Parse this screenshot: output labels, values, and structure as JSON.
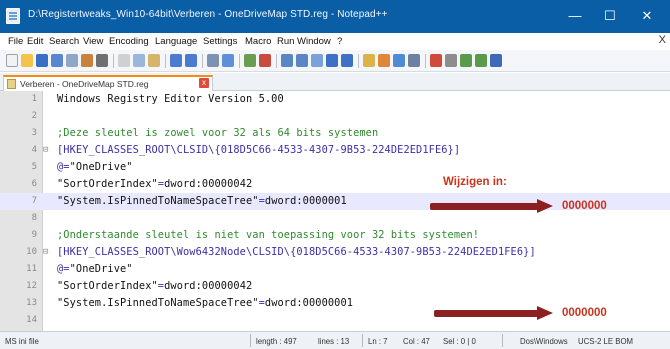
{
  "window": {
    "title": "D:\\Registertweaks_Win10-64bit\\Verberen - OneDriveMap STD.reg - Notepad++",
    "min_glyph": "—",
    "max_glyph": "☐",
    "close_glyph": "✕"
  },
  "menu": {
    "items": [
      "File",
      "Edit",
      "Search",
      "View",
      "Encoding",
      "Language",
      "Settings",
      "Macro",
      "Run",
      "Window",
      "?"
    ],
    "close_glyph": "X"
  },
  "tab": {
    "label": "Verberen - OneDriveMap STD.reg",
    "close_glyph": "x"
  },
  "editor": {
    "current_line_index": 6,
    "lines": [
      {
        "num": "1",
        "fold": "",
        "segments": [
          {
            "t": "Windows Registry Editor Version 5.00",
            "c": "norm"
          }
        ]
      },
      {
        "num": "2",
        "fold": "",
        "segments": []
      },
      {
        "num": "3",
        "fold": "",
        "segments": [
          {
            "t": ";Deze sleutel is zowel voor 32 als 64 bits systemen",
            "c": "comment"
          }
        ]
      },
      {
        "num": "4",
        "fold": "⊟",
        "segments": [
          {
            "t": "[HKEY_CLASSES_ROOT\\CLSID\\{018D5C66-4533-4307-9B53-224DE2ED1FE6}]",
            "c": "key"
          }
        ]
      },
      {
        "num": "5",
        "fold": "",
        "segments": [
          {
            "t": "@=",
            "c": "key"
          },
          {
            "t": "\"OneDrive\"",
            "c": "norm"
          }
        ]
      },
      {
        "num": "6",
        "fold": "",
        "segments": [
          {
            "t": "\"SortOrderIndex\"",
            "c": "norm"
          },
          {
            "t": "=",
            "c": "key"
          },
          {
            "t": "dword:00000042",
            "c": "norm"
          }
        ]
      },
      {
        "num": "7",
        "fold": "",
        "segments": [
          {
            "t": "\"System.IsPinnedToNameSpaceTree\"",
            "c": "norm"
          },
          {
            "t": "=",
            "c": "key"
          },
          {
            "t": "dword:0000001",
            "c": "norm"
          }
        ]
      },
      {
        "num": "8",
        "fold": "",
        "segments": []
      },
      {
        "num": "9",
        "fold": "",
        "segments": [
          {
            "t": ";Onderstaande sleutel is niet van toepassing voor 32 bits systemen!",
            "c": "comment"
          }
        ]
      },
      {
        "num": "10",
        "fold": "⊟",
        "segments": [
          {
            "t": "[HKEY_CLASSES_ROOT\\Wow6432Node\\CLSID\\{018D5C66-4533-4307-9B53-224DE2ED1FE6}]",
            "c": "key"
          }
        ]
      },
      {
        "num": "11",
        "fold": "",
        "segments": [
          {
            "t": "@=",
            "c": "key"
          },
          {
            "t": "\"OneDrive\"",
            "c": "norm"
          }
        ]
      },
      {
        "num": "12",
        "fold": "",
        "segments": [
          {
            "t": "\"SortOrderIndex\"",
            "c": "norm"
          },
          {
            "t": "=",
            "c": "key"
          },
          {
            "t": "dword:00000042",
            "c": "norm"
          }
        ]
      },
      {
        "num": "13",
        "fold": "",
        "segments": [
          {
            "t": "\"System.IsPinnedToNameSpaceTree\"",
            "c": "norm"
          },
          {
            "t": "=",
            "c": "key"
          },
          {
            "t": "dword:00000001",
            "c": "norm"
          }
        ]
      },
      {
        "num": "14",
        "fold": "",
        "segments": []
      }
    ]
  },
  "annotations": {
    "label": "Wijzigen in:",
    "value_1": "0000000",
    "value_2": "0000000",
    "color": "#c8341d",
    "arrow_color": "#8c1f1f"
  },
  "status": {
    "file_type": "MS ini file",
    "length": "length : 497",
    "lines": "lines : 13",
    "ln": "Ln : 7",
    "col": "Col : 47",
    "sel": "Sel : 0 | 0",
    "eol": "Dos\\Windows",
    "encoding": "UCS-2 LE BOM"
  },
  "colors": {
    "titlebar": "#0a5ea6",
    "comment": "#2f8a2f",
    "key": "#3c2fa8",
    "tab_accent": "#f28b17"
  }
}
